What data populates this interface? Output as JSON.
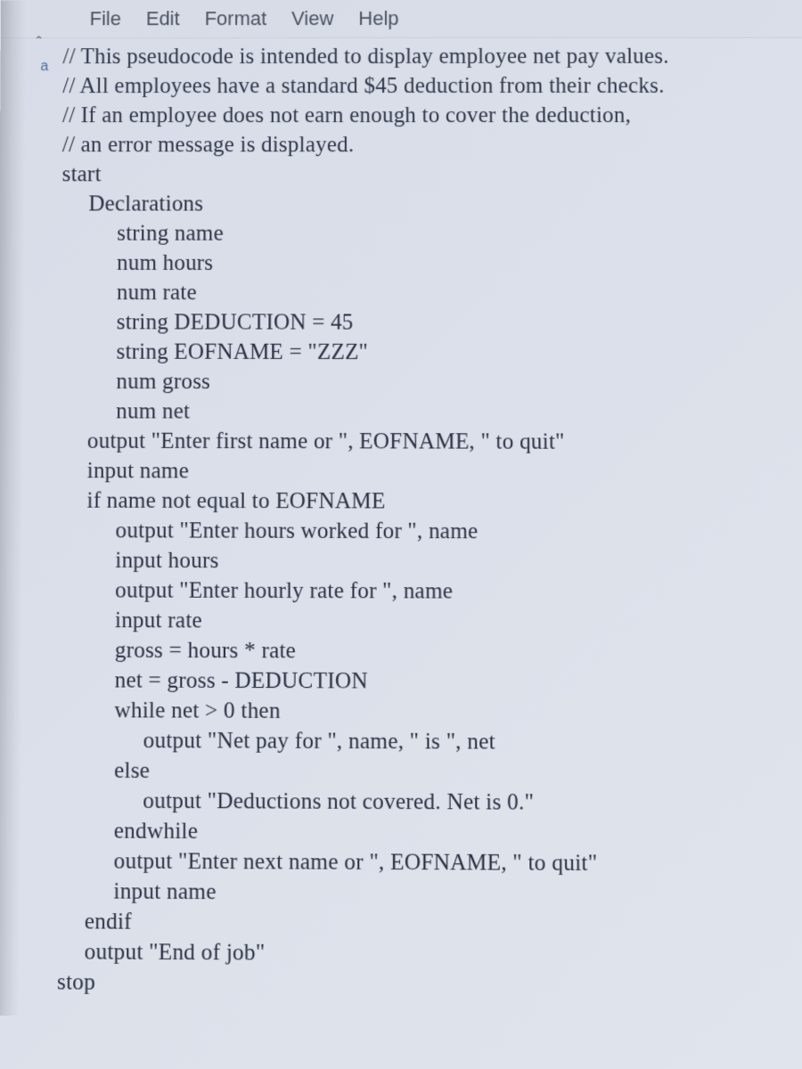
{
  "menu": {
    "file": "File",
    "edit": "Edit",
    "format": "Format",
    "view": "View",
    "help": "Help"
  },
  "scroll_glyph": "ˆ",
  "gutter_marker": "a",
  "code": {
    "c1": "// This pseudocode is intended to display employee net pay values.",
    "c2": "// All employees have a standard $45 deduction from their checks.",
    "c3": "// If an employee does not earn enough to cover the deduction,",
    "c4": "// an error message is displayed.",
    "l5": "start",
    "l6": "Declarations",
    "l7": "string name",
    "l8": "num hours",
    "l9": "num rate",
    "l10": "string DEDUCTION = 45",
    "l11": "string EOFNAME = \"ZZZ\"",
    "l12": "num gross",
    "l13": "num net",
    "l14": "output \"Enter first name or \", EOFNAME, \" to quit\"",
    "l15": "input name",
    "l16": "if name not equal to EOFNAME",
    "l17": "output \"Enter hours worked for \", name",
    "l18": "input hours",
    "l19": "output \"Enter hourly rate for \", name",
    "l20": "input rate",
    "l21": "gross = hours * rate",
    "l22": "net = gross - DEDUCTION",
    "l23": "while net > 0 then",
    "l24": "output \"Net pay for \", name, \" is \", net",
    "l25": "else",
    "l26": "output \"Deductions not covered. Net is 0.\"",
    "l27": "endwhile",
    "l28": "output \"Enter next name or \", EOFNAME, \" to quit\"",
    "l29": "input name",
    "l30": "endif",
    "l31": "output \"End of job\"",
    "l32": "stop"
  }
}
